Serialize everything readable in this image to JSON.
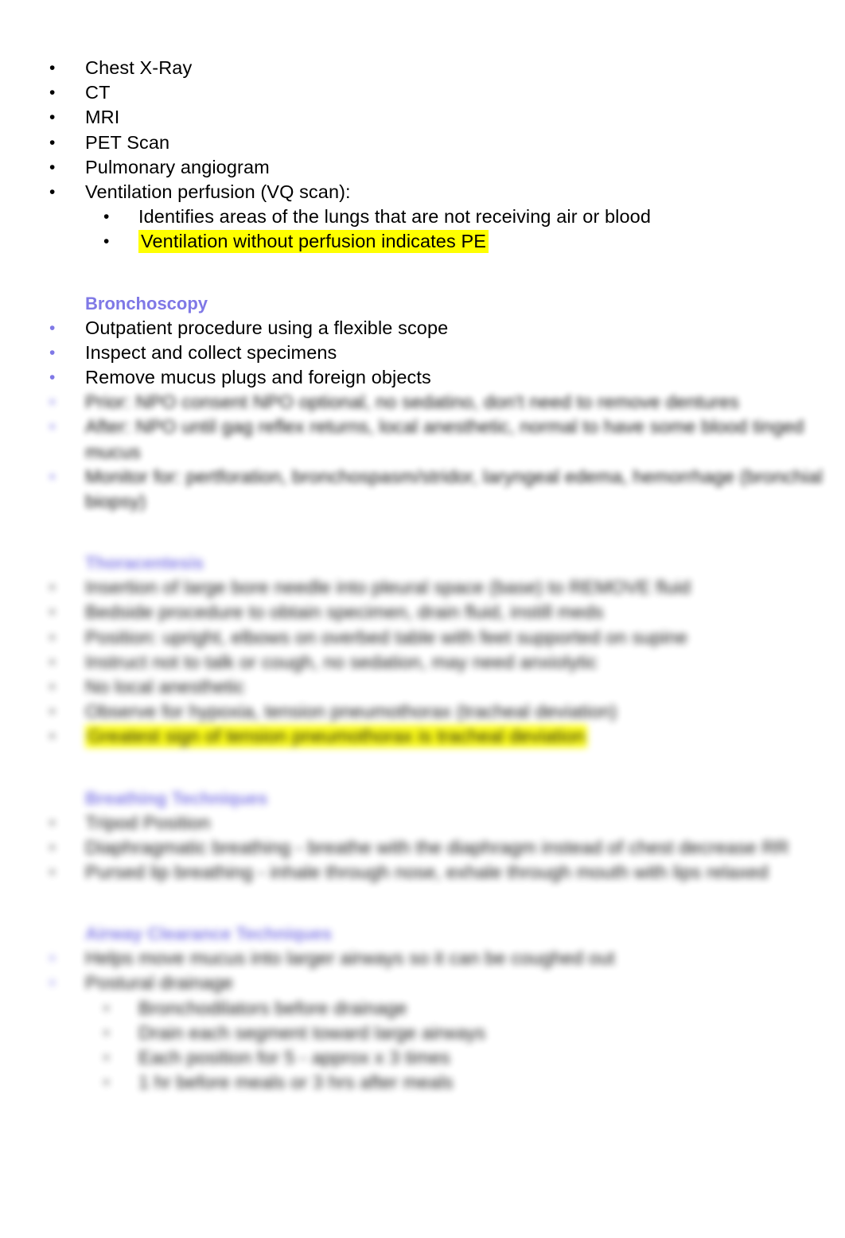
{
  "document": {
    "background_color": "#ffffff",
    "text_color": "#000000",
    "heading_color": "#7f78e6",
    "highlight_color": "#ffff00",
    "bullet_glyph": "•"
  },
  "imaging_list": {
    "items": [
      {
        "label": "Chest X-Ray",
        "level": 1,
        "bullet_color": "#000000",
        "highlighted": false
      },
      {
        "label": "CT",
        "level": 1,
        "bullet_color": "#000000",
        "highlighted": false
      },
      {
        "label": "MRI",
        "level": 1,
        "bullet_color": "#000000",
        "highlighted": false
      },
      {
        "label": "PET Scan",
        "level": 1,
        "bullet_color": "#000000",
        "highlighted": false
      },
      {
        "label": "Pulmonary angiogram",
        "level": 1,
        "bullet_color": "#000000",
        "highlighted": false
      },
      {
        "label": "Ventilation perfusion (VQ scan):",
        "level": 1,
        "bullet_color": "#000000",
        "highlighted": false
      },
      {
        "label": "Identifies areas of the lungs that are not receiving air or blood",
        "level": 2,
        "bullet_color": "#000000",
        "highlighted": false
      },
      {
        "label": "Ventilation without perfusion indicates PE",
        "level": 2,
        "bullet_color": "#000000",
        "highlighted": true
      }
    ]
  },
  "bronchoscopy": {
    "heading": "Bronchoscopy",
    "items": [
      {
        "label": "Outpatient procedure using a flexible scope",
        "level": 1,
        "bullet_color": "#7f78e6",
        "highlighted": false
      },
      {
        "label": "Inspect and collect specimens",
        "level": 1,
        "bullet_color": "#7f78e6",
        "highlighted": false
      },
      {
        "label": "Remove mucus plugs and foreign objects",
        "level": 1,
        "bullet_color": "#7f78e6",
        "highlighted": false
      }
    ],
    "blurred_items": [
      {
        "label": "Prior: NPO consent NPO optional, no sedatino, don't need to remove dentures",
        "level": 1,
        "bullet_color": "#7f78e6",
        "blurred": true
      },
      {
        "label": "After: NPO until gag reflex returns, local anesthetic, normal to have some blood tinged mucus",
        "level": 1,
        "bullet_color": "#7f78e6",
        "blurred": true
      },
      {
        "label": "Monitor for: pertforation, bronchospasm/stridor, laryngeal edema, hemorrhage (bronchial biopsy)",
        "level": 1,
        "bullet_color": "#7f78e6",
        "blurred": true
      }
    ]
  },
  "thoracentesis": {
    "heading": "Thoracentesis",
    "blurred": true,
    "items": [
      {
        "label": "Insertion of large bore needle into pleural space (base) to REMOVE fluid",
        "level": 1,
        "bullet_color": "#555555",
        "blurred": true,
        "highlighted": false
      },
      {
        "label": "Bedside procedure to obtain specimen, drain fluid, instill meds",
        "level": 1,
        "bullet_color": "#555555",
        "blurred": true,
        "highlighted": false
      },
      {
        "label": "Position: upright, elbows on overbed table with feet supported on supine",
        "level": 1,
        "bullet_color": "#555555",
        "blurred": true,
        "highlighted": false
      },
      {
        "label": "Instruct not to talk or cough, no sedation, may need anxiolytic",
        "level": 1,
        "bullet_color": "#555555",
        "blurred": true,
        "highlighted": false
      },
      {
        "label": "No local anesthetic",
        "level": 1,
        "bullet_color": "#555555",
        "blurred": true,
        "highlighted": false
      },
      {
        "label": "Observe for hypoxia, tension pneumothorax (tracheal deviation)",
        "level": 1,
        "bullet_color": "#555555",
        "blurred": true,
        "highlighted": false
      },
      {
        "label": "Greatest sign of tension pneumothorax is tracheal deviation",
        "level": 1,
        "bullet_color": "#555555",
        "blurred": true,
        "highlighted": true
      }
    ]
  },
  "breathing_techniques": {
    "heading": "Breathing Techniques",
    "blurred": true,
    "items": [
      {
        "label": "Tripod Position",
        "level": 1,
        "bullet_color": "#555555",
        "blurred": true
      },
      {
        "label": "Diaphragmatic breathing - breathe with the diaphragm instead of chest decrease RR",
        "level": 1,
        "bullet_color": "#555555",
        "blurred": true
      },
      {
        "label": "Pursed lip breathing - inhale through nose, exhale through mouth with lips relaxed",
        "level": 1,
        "bullet_color": "#555555",
        "blurred": true
      }
    ]
  },
  "airway_clearance": {
    "heading": "Airway Clearance Techniques",
    "blurred": true,
    "items": [
      {
        "label": "Helps move mucus into larger airways so it can be coughed out",
        "level": 1,
        "bullet_color": "#8b84ea",
        "blurred": true
      },
      {
        "label": "Postural drainage",
        "level": 1,
        "bullet_color": "#8b84ea",
        "blurred": true
      },
      {
        "label": "Bronchodilators before drainage",
        "level": 2,
        "bullet_color": "#555555",
        "blurred": true
      },
      {
        "label": "Drain each segment toward large airways",
        "level": 2,
        "bullet_color": "#555555",
        "blurred": true
      },
      {
        "label": "Each position for 5 - approx x 3 times",
        "level": 2,
        "bullet_color": "#555555",
        "blurred": true
      },
      {
        "label": "1 hr before meals or 3 hrs after meals",
        "level": 2,
        "bullet_color": "#555555",
        "blurred": true
      }
    ]
  }
}
